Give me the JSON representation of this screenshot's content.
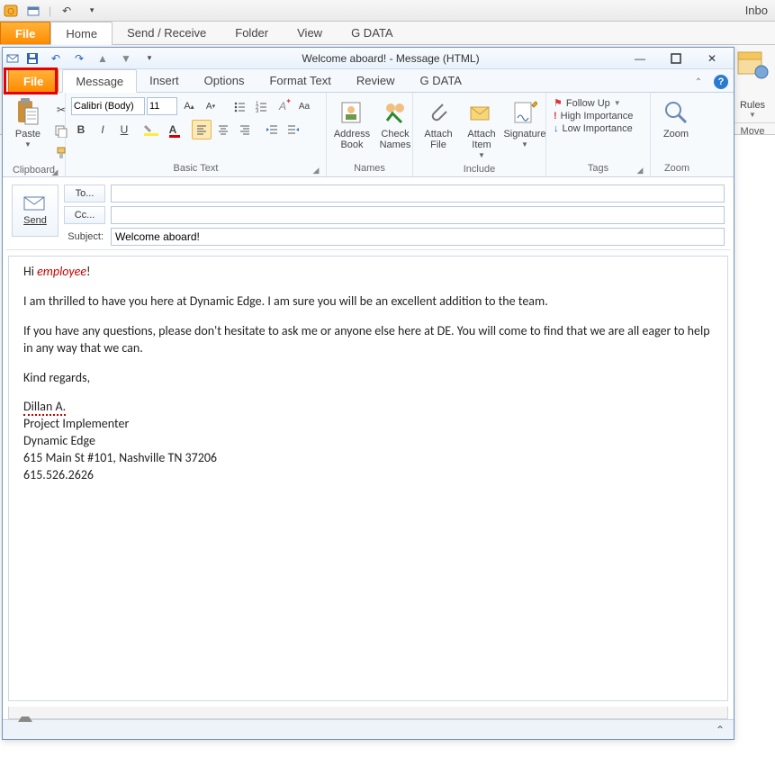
{
  "parent": {
    "title_right": "Inbo",
    "tabs": {
      "file": "File",
      "home": "Home",
      "sendreceive": "Send / Receive",
      "folder": "Folder",
      "view": "View",
      "gdata": "G DATA"
    },
    "right_group": {
      "rules": "Rules",
      "move": "Move"
    }
  },
  "msg": {
    "title": "Welcome aboard!  -  Message (HTML)",
    "tabs": {
      "file": "File",
      "message": "Message",
      "insert": "Insert",
      "options": "Options",
      "format": "Format Text",
      "review": "Review",
      "gdata": "G DATA"
    },
    "ribbon": {
      "clipboard": {
        "paste": "Paste",
        "label": "Clipboard"
      },
      "basic": {
        "font": "Calibri (Body)",
        "size": "11",
        "label": "Basic Text"
      },
      "names": {
        "address": "Address\nBook",
        "check": "Check\nNames",
        "label": "Names"
      },
      "include": {
        "attachfile": "Attach\nFile",
        "attachitem": "Attach\nItem",
        "signature": "Signature",
        "label": "Include"
      },
      "tags": {
        "follow": "Follow Up",
        "high": "High Importance",
        "low": "Low Importance",
        "label": "Tags"
      },
      "zoom": {
        "zoom": "Zoom",
        "label": "Zoom"
      }
    },
    "compose": {
      "send": "Send",
      "to": "To...",
      "cc": "Cc...",
      "subject_label": "Subject:",
      "to_val": "",
      "cc_val": "",
      "subject_val": "Welcome aboard!"
    },
    "body": {
      "hi_pre": "Hi ",
      "hi_emp": "employee",
      "hi_post": "!",
      "p1": "I am thrilled to have you here at Dynamic Edge. I am sure you will be an excellent addition to the team.",
      "p2": "If you have any questions, please don't hesitate to ask me or anyone else here at DE. You will come to find that we are all eager to help in any way that we can.",
      "regards": "Kind regards,",
      "sig_name": "Dillan A.",
      "sig_role": "Project Implementer",
      "sig_company": "Dynamic Edge",
      "sig_addr": "615 Main St #101, Nashville TN 37206",
      "sig_phone": "615.526.2626"
    }
  }
}
